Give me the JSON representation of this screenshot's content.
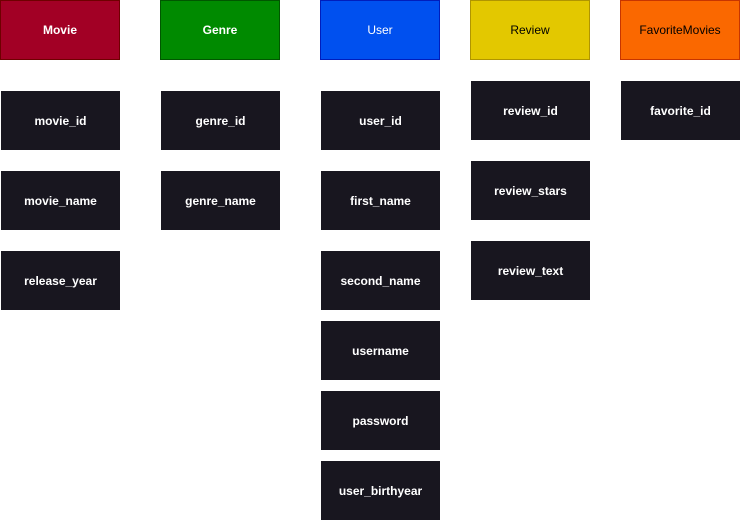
{
  "entities": [
    {
      "name": "Movie",
      "header_bg": "#a20025",
      "header_border": "#6f0000",
      "header_text_color": "#ffffff",
      "fields": [
        "movie_id",
        "movie_name",
        "release_year"
      ]
    },
    {
      "name": "Genre",
      "header_bg": "#008a00",
      "header_border": "#005700",
      "header_text_color": "#ffffff",
      "fields": [
        "genre_id",
        "genre_name"
      ]
    },
    {
      "name": "User",
      "header_bg": "#0050ef",
      "header_border": "#001dbc",
      "header_text_color": "#ffffff",
      "fields": [
        "user_id",
        "first_name",
        "second_name",
        "username",
        "password",
        "user_birthyear"
      ]
    },
    {
      "name": "Review",
      "header_bg": "#e3c800",
      "header_border": "#b09500",
      "header_text_color": "#000000",
      "fields": [
        "review_id",
        "review_stars",
        "review_text"
      ]
    },
    {
      "name": "FavoriteMovies",
      "header_bg": "#fa6800",
      "header_border": "#c73500",
      "header_text_color": "#000000",
      "fields": [
        "favorite_id"
      ]
    }
  ],
  "field_bg": "#18161f",
  "field_text_color": "#ffffff"
}
